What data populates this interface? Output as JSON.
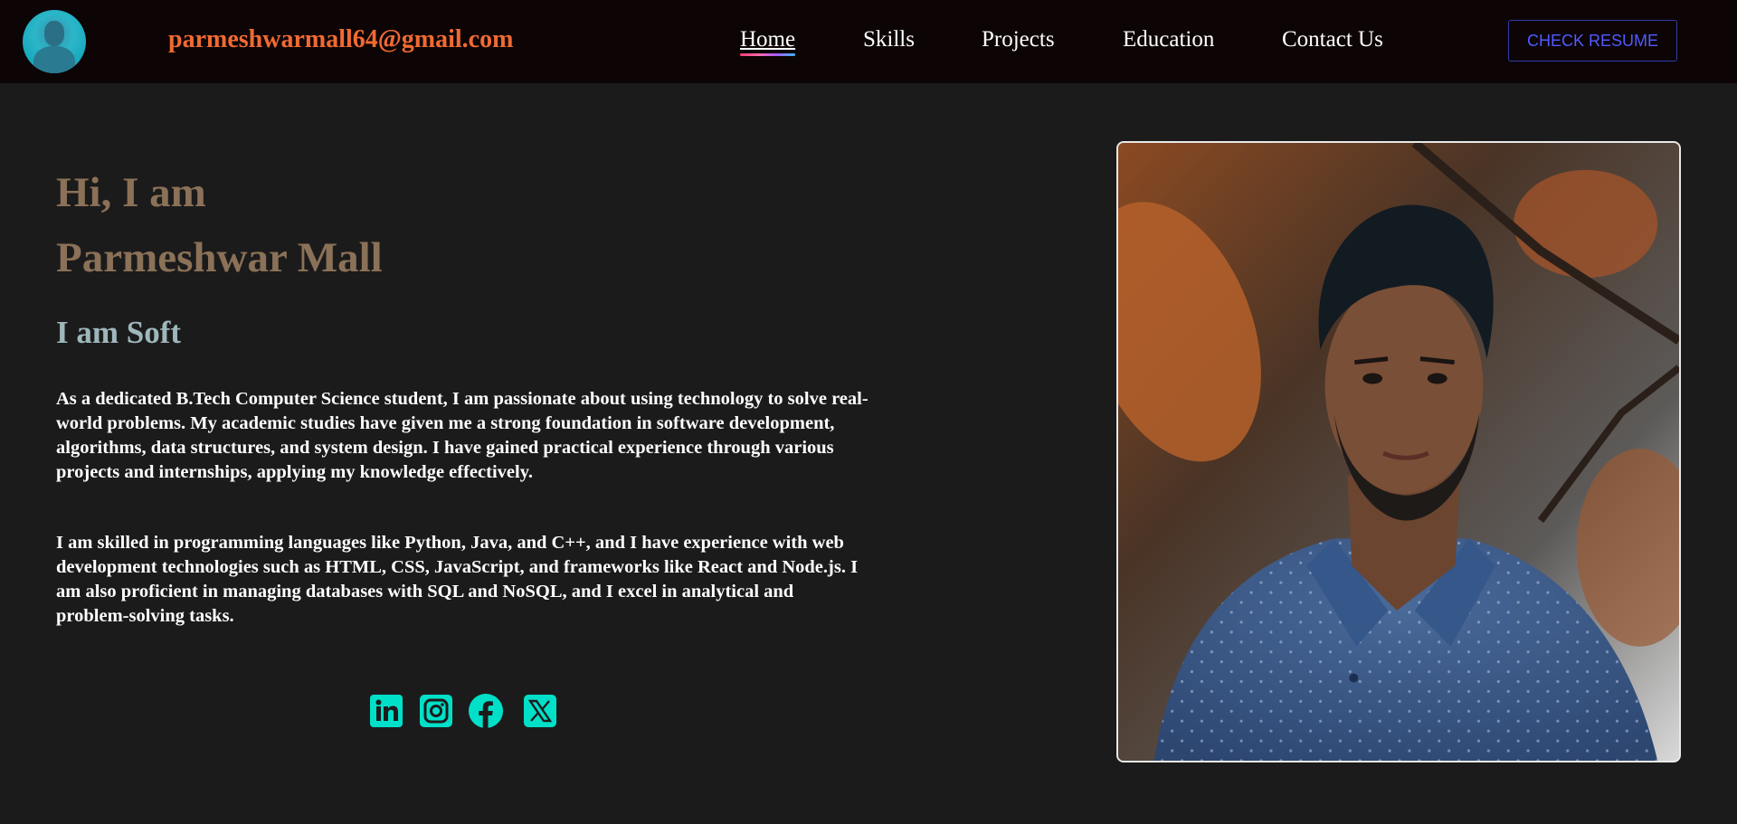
{
  "header": {
    "email": "parmeshwarmall64@gmail.com",
    "nav": [
      {
        "label": "Home",
        "active": true
      },
      {
        "label": "Skills",
        "active": false
      },
      {
        "label": "Projects",
        "active": false
      },
      {
        "label": "Education",
        "active": false
      },
      {
        "label": "Contact Us",
        "active": false
      }
    ],
    "resume_label": "CHECK RESUME"
  },
  "hero": {
    "greeting": "Hi, I am",
    "name": "Parmeshwar Mall",
    "role_typed": "I am Soft",
    "paragraphs": [
      "As a dedicated B.Tech Computer Science student, I am passionate about using technology to solve real-world problems. My academic studies have given me a strong foundation in software development, algorithms, data structures, and system design. I have gained practical experience through various projects and internships, applying my knowledge effectively.",
      "I am skilled in programming languages like Python, Java, and C++, and I have experience with web development technologies such as HTML, CSS, JavaScript, and frameworks like React and Node.js. I am also proficient in managing databases with SQL and NoSQL, and I excel in analytical and problem-solving tasks."
    ],
    "socials": [
      "linkedin-icon",
      "instagram-icon",
      "facebook-icon",
      "x-icon"
    ]
  },
  "colors": {
    "background": "#1c1b1c",
    "header_bg": "#0d0405",
    "email": "#f06a33",
    "heading": "#8a7157",
    "role": "#9eb7bb",
    "social": "#00e0c8",
    "resume": "#4f5bff"
  }
}
